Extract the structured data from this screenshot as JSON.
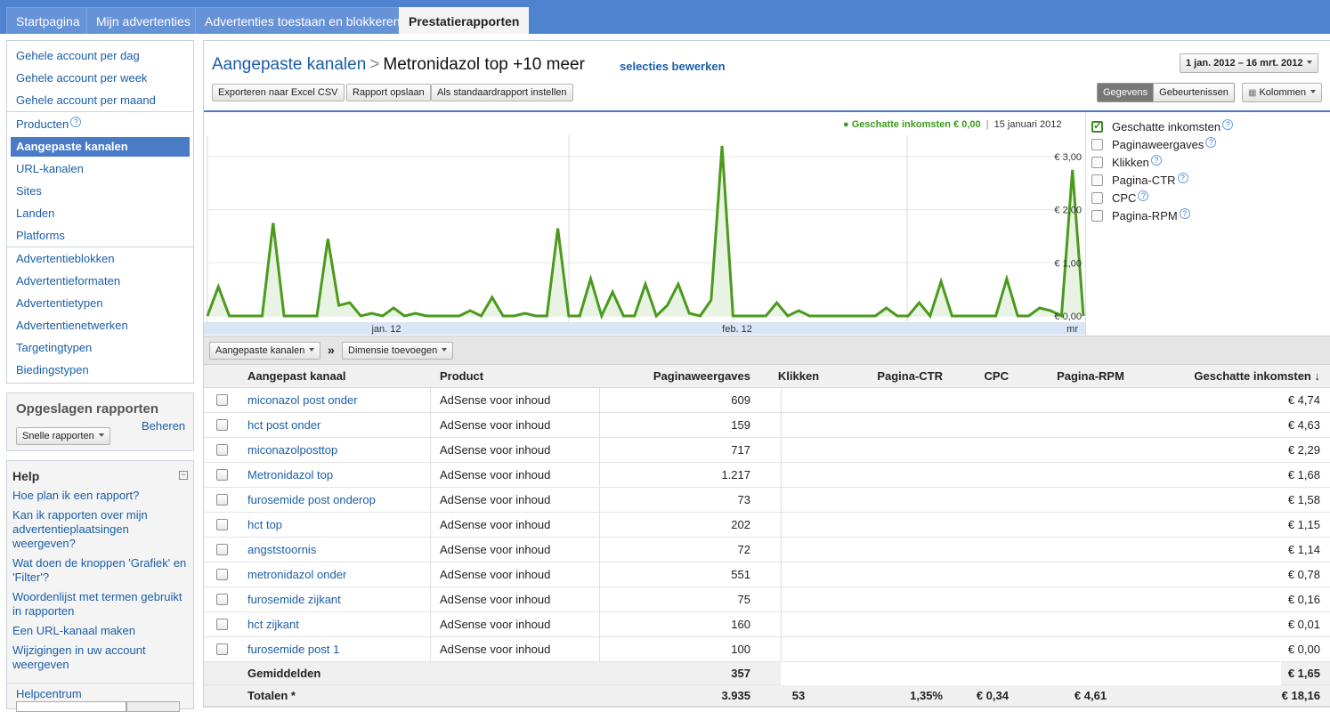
{
  "topnav": {
    "tabs": [
      {
        "label": "Startpagina"
      },
      {
        "label": "Mijn advertenties"
      },
      {
        "label": "Advertenties toestaan en blokkeren"
      },
      {
        "label": "Prestatierapporten"
      }
    ]
  },
  "sidebar": {
    "groups": [
      [
        "Gehele account per dag",
        "Gehele account per week",
        "Gehele account per maand"
      ],
      [
        "Producten",
        "Aangepaste kanalen",
        "URL-kanalen",
        "Sites",
        "Landen",
        "Platforms"
      ],
      [
        "Advertentieblokken",
        "Advertentieformaten",
        "Advertentietypen",
        "Advertentienetwerken",
        "Targetingtypen",
        "Biedingstypen"
      ]
    ],
    "active": "Aangepaste kanalen"
  },
  "saved": {
    "title": "Opgeslagen rapporten",
    "quick": "Snelle rapporten",
    "manage": "Beheren"
  },
  "help": {
    "title": "Help",
    "collapse": "−",
    "links": [
      "Hoe plan ik een rapport?",
      "Kan ik rapporten over mijn advertentieplaatsingen weergeven?",
      "Wat doen de knoppen 'Grafiek' en 'Filter'?",
      "Woordenlijst met termen gebruikt in rapporten",
      "Een URL-kanaal maken",
      "Wijzigingen in uw account weergeven"
    ],
    "center": "Helpcentrum"
  },
  "report": {
    "crumb_parent": "Aangepaste kanalen",
    "crumb_sep": ">",
    "crumb_current": "Metronidazol top +10 meer",
    "edit_selection": "selecties bewerken",
    "date_range": "1 jan. 2012 – 16 mrt. 2012",
    "buttons": {
      "export": "Exporteren naar Excel CSV",
      "save": "Rapport opslaan",
      "default": "Als standaardrapport instellen"
    },
    "view_toggle": {
      "data": "Gegevens",
      "events": "Gebeurtenissen"
    },
    "columns_button": "Kolommen"
  },
  "chart_legend": {
    "bullet": "●",
    "series_label": "Geschatte inkomsten € 0,00",
    "divider": "|",
    "date": "15 januari 2012"
  },
  "metrics": [
    {
      "label": "Geschatte inkomsten",
      "checked": true
    },
    {
      "label": "Paginaweergaves",
      "checked": false
    },
    {
      "label": "Klikken",
      "checked": false
    },
    {
      "label": "Pagina-CTR",
      "checked": false
    },
    {
      "label": "CPC",
      "checked": false
    },
    {
      "label": "Pagina-RPM",
      "checked": false
    }
  ],
  "help_icon": "?",
  "chart_data": {
    "type": "area",
    "series": [
      {
        "name": "Geschatte inkomsten",
        "color": "#4a9a1c",
        "values": [
          0.0,
          0.55,
          0.0,
          0.0,
          0.0,
          0.0,
          1.75,
          0.0,
          0.0,
          0.0,
          0.0,
          1.45,
          0.2,
          0.25,
          0.0,
          0.05,
          0.0,
          0.15,
          0.0,
          0.05,
          0.0,
          0.0,
          0.0,
          0.0,
          0.1,
          0.0,
          0.35,
          0.0,
          0.0,
          0.05,
          0.0,
          0.0,
          1.65,
          0.0,
          0.0,
          0.7,
          0.0,
          0.45,
          0.0,
          0.0,
          0.6,
          0.0,
          0.2,
          0.6,
          0.05,
          0.0,
          0.3,
          3.2,
          0.0,
          0.0,
          0.0,
          0.0,
          0.25,
          0.0,
          0.1,
          0.0,
          0.0,
          0.0,
          0.0,
          0.0,
          0.0,
          0.0,
          0.15,
          0.0,
          0.0,
          0.25,
          0.0,
          0.65,
          0.0,
          0.0,
          0.0,
          0.0,
          0.0,
          0.7,
          0.0,
          0.0,
          0.15,
          0.1,
          0.0,
          2.75,
          0.0
        ]
      }
    ],
    "x_tick_labels": [
      "jan. 12",
      "feb. 12",
      "mr"
    ],
    "y_tick_labels": [
      "€ 3,00",
      "€ 2,00",
      "€ 1,00",
      "€ 0,00"
    ],
    "ylim": [
      0,
      3.4
    ]
  },
  "dimension_bar": {
    "primary": "Aangepaste kanalen",
    "separator": "»",
    "add": "Dimensie toevoegen"
  },
  "table": {
    "headers": [
      "Aangepast kanaal",
      "Product",
      "Paginaweergaves",
      "Klikken",
      "Pagina-CTR",
      "CPC",
      "Pagina-RPM",
      "Geschatte inkomsten ↓"
    ],
    "rows": [
      [
        "miconazol post onder",
        "AdSense voor inhoud",
        "609",
        "€ 4,74"
      ],
      [
        "hct post onder",
        "AdSense voor inhoud",
        "159",
        "€ 4,63"
      ],
      [
        "miconazolposttop",
        "AdSense voor inhoud",
        "717",
        "€ 2,29"
      ],
      [
        "Metronidazol top",
        "AdSense voor inhoud",
        "1.217",
        "€ 1,68"
      ],
      [
        "furosemide post onderop",
        "AdSense voor inhoud",
        "73",
        "€ 1,58"
      ],
      [
        "hct top",
        "AdSense voor inhoud",
        "202",
        "€ 1,15"
      ],
      [
        "angststoornis",
        "AdSense voor inhoud",
        "72",
        "€ 1,14"
      ],
      [
        "metronidazol onder",
        "AdSense voor inhoud",
        "551",
        "€ 0,78"
      ],
      [
        "furosemide zijkant",
        "AdSense voor inhoud",
        "75",
        "€ 0,16"
      ],
      [
        "hct zijkant",
        "AdSense voor inhoud",
        "160",
        "€ 0,01"
      ],
      [
        "furosemide post 1",
        "AdSense voor inhoud",
        "100",
        "€ 0,00"
      ]
    ],
    "averages": {
      "label": "Gemiddelden",
      "pageviews": "357",
      "earnings": "€ 1,65"
    },
    "totals": {
      "label": "Totalen *",
      "pageviews": "3.935",
      "clicks": "53",
      "ctr": "1,35%",
      "cpc": "€ 0,34",
      "rpm": "€ 4,61",
      "earnings": "€ 18,16"
    }
  }
}
